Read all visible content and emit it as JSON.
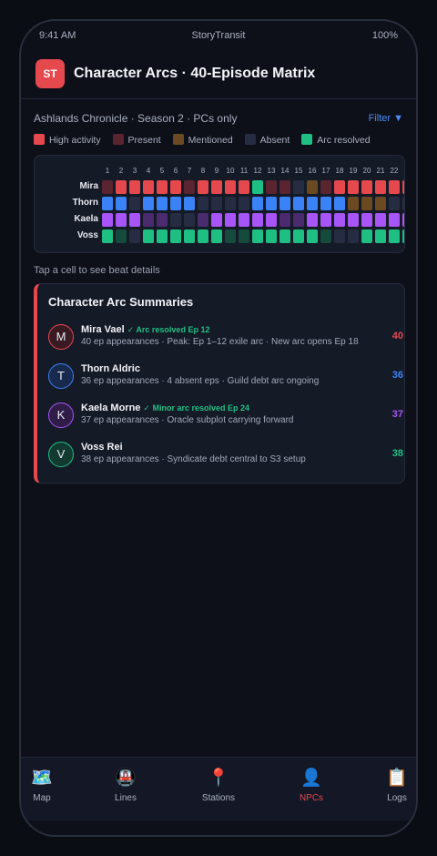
{
  "status_bar": {
    "time": "9:41 AM",
    "carrier": "StoryTransit",
    "battery": "100%"
  },
  "header": {
    "logo": "ST",
    "title": "Character Arcs · 40-Episode Matrix"
  },
  "context": {
    "subtitle": "Ashlands Chronicle · Season 2 · PCs only",
    "filter_label": "Filter ▼"
  },
  "legend": [
    {
      "label": "High activity",
      "color": "#e5484d"
    },
    {
      "label": "Present",
      "color": "#5a2430"
    },
    {
      "label": "Mentioned",
      "color": "#6b4a22"
    },
    {
      "label": "Absent",
      "color": "#262c42"
    },
    {
      "label": "Arc resolved",
      "color": "#1fbf83"
    }
  ],
  "matrix": {
    "episodes": [
      "1",
      "2",
      "3",
      "4",
      "5",
      "6",
      "7",
      "8",
      "9",
      "10",
      "11",
      "12",
      "13",
      "14",
      "15",
      "16",
      "17",
      "18",
      "19",
      "20",
      "21",
      "22",
      "23"
    ],
    "rows": [
      {
        "label": "Mira",
        "cells": [
          "p",
          "h",
          "h",
          "h",
          "h",
          "h",
          "p",
          "h",
          "h",
          "h",
          "h",
          "r",
          "p",
          "p",
          "a",
          "m",
          "p",
          "h",
          "h",
          "h",
          "h",
          "h",
          "h"
        ]
      },
      {
        "label": "Thorn",
        "cells": [
          "h",
          "h",
          "a",
          "h",
          "h",
          "h",
          "h",
          "a",
          "a",
          "a",
          "a",
          "h",
          "h",
          "h",
          "h",
          "h",
          "h",
          "h",
          "m",
          "m",
          "m",
          "a",
          "a"
        ]
      },
      {
        "label": "Kaela",
        "cells": [
          "h",
          "h",
          "h",
          "p",
          "p",
          "a",
          "a",
          "p",
          "h",
          "h",
          "h",
          "h",
          "h",
          "p",
          "p",
          "h",
          "h",
          "h",
          "h",
          "h",
          "h",
          "h",
          "h"
        ]
      },
      {
        "label": "Voss",
        "cells": [
          "h",
          "p",
          "a",
          "h",
          "h",
          "h",
          "h",
          "h",
          "h",
          "p",
          "p",
          "h",
          "h",
          "h",
          "h",
          "h",
          "p",
          "a",
          "a",
          "h",
          "h",
          "h",
          "h"
        ]
      }
    ],
    "row_colors": [
      {
        "h": "#e5484d",
        "p": "#5a2430",
        "m": "#6b4a22",
        "a": "#262c42",
        "r": "#1fbf83"
      },
      {
        "h": "#3b82f6",
        "p": "#1c3566",
        "m": "#6b4a22",
        "a": "#262c42",
        "r": "#1fbf83"
      },
      {
        "h": "#a855f7",
        "p": "#4a2b6e",
        "m": "#6b4a22",
        "a": "#262c42",
        "r": "#1fbf83"
      },
      {
        "h": "#1fbf83",
        "p": "#154a3d",
        "m": "#6b4a22",
        "a": "#262c42",
        "r": "#1fbf83"
      }
    ]
  },
  "hint": "Tap a cell to see beat details",
  "summaries": {
    "title": "Character Arc Summaries",
    "items": [
      {
        "initial": "M",
        "name": "Mira Vael",
        "badge": "✓ Arc resolved Ep 12",
        "detail": "40 ep appearances · Peak: Ep 1–12 exile arc · New arc opens Ep 18",
        "count": "40",
        "color": "#e5484d",
        "avatar_bg": "#3a1a22"
      },
      {
        "initial": "T",
        "name": "Thorn Aldric",
        "badge": "",
        "detail": "36 ep appearances · 4 absent eps · Guild debt arc ongoing",
        "count": "36",
        "color": "#3b82f6",
        "avatar_bg": "#172a4d"
      },
      {
        "initial": "K",
        "name": "Kaela Morne",
        "badge": "✓ Minor arc resolved Ep 24",
        "detail": "37 ep appearances · Oracle subplot carrying forward",
        "count": "37",
        "color": "#a855f7",
        "avatar_bg": "#2f1c47"
      },
      {
        "initial": "V",
        "name": "Voss Rei",
        "badge": "",
        "detail": "38 ep appearances · Syndicate debt central to S3 setup",
        "count": "38",
        "color": "#1fbf83",
        "avatar_bg": "#123a30"
      }
    ]
  },
  "tabs": [
    {
      "icon": "🗺️",
      "label": "Map",
      "active": false
    },
    {
      "icon": "🚇",
      "label": "Lines",
      "active": false
    },
    {
      "icon": "📍",
      "label": "Stations",
      "active": false
    },
    {
      "icon": "👤",
      "label": "NPCs",
      "active": true
    },
    {
      "icon": "📋",
      "label": "Logs",
      "active": false
    }
  ]
}
